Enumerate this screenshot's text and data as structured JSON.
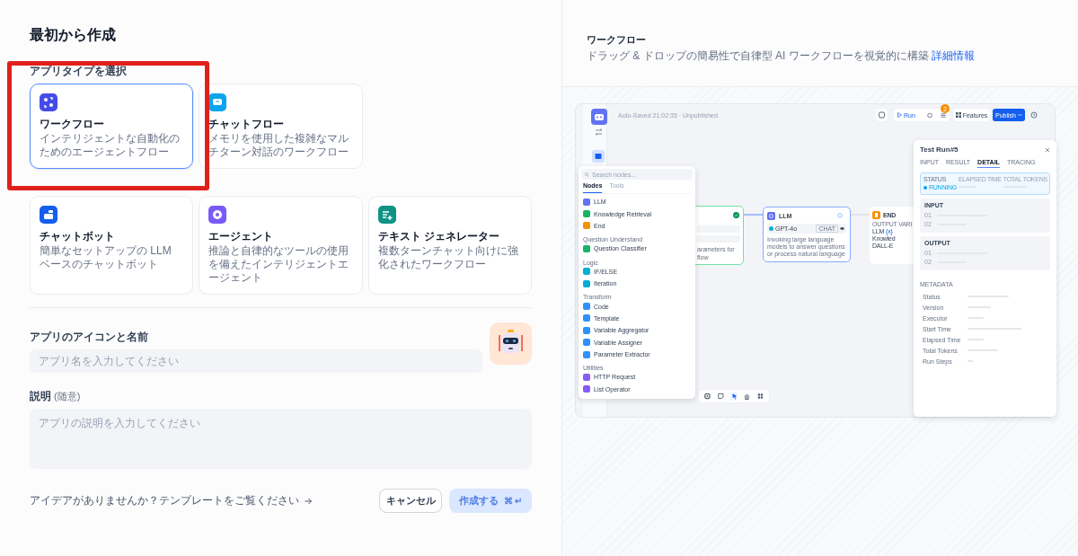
{
  "heading": "最初から作成",
  "app_type_label": "アプリタイプを選択",
  "primary_types": [
    {
      "kind": "workflow",
      "title": "ワークフロー",
      "description": "インテリジェントな自動化のためのエージェントフロー",
      "selected": true,
      "color": "#444ce7"
    },
    {
      "kind": "chatflow",
      "title": "チャットフロー",
      "description": "メモリを使用した複雑なマルチターン対話のワークフロー",
      "selected": false,
      "color": "#0ba5ec"
    }
  ],
  "more_types": [
    {
      "kind": "chatbot",
      "title": "チャットボット",
      "description": "簡単なセットアップの LLM ベースのチャットボット",
      "selected": false,
      "color": "#155eef"
    },
    {
      "kind": "agent",
      "title": "エージェント",
      "description": "推論と自律的なツールの使用を備えたインテリジェントエージェント",
      "selected": false,
      "color": "#7a5af8"
    },
    {
      "kind": "textgen",
      "title": "テキスト ジェネレーター",
      "description": "複数ターンチャット向けに強化されたワークフロー",
      "selected": false,
      "color": "#0e9384"
    }
  ],
  "name_field": {
    "label": "アプリのアイコンと名前",
    "placeholder": "アプリ名を入力してください"
  },
  "description_field": {
    "label": "説明",
    "optional": "(随意)",
    "placeholder": "アプリの説明を入力してください"
  },
  "footer": {
    "template_link": "アイデアがありませんか？テンプレートをご覧ください",
    "cancel": "キャンセル",
    "create": {
      "label": "作成する",
      "shortcut": [
        "⌘",
        "↵"
      ],
      "disabled": true
    }
  },
  "preview": {
    "title": "ワークフロー",
    "description": "ドラッグ & ドロップの簡易性で自律型 AI ワークフローを視覚的に構築",
    "link": "詳細情報",
    "app": {
      "autosave": "Auto-Saved 21:02:35 · Unpublished",
      "run": "Run",
      "badge": "2",
      "features": "Features",
      "publish": "Publish",
      "node_panel": {
        "search_placeholder": "Search nodes...",
        "tabs": [
          {
            "label": "Nodes",
            "selected": true
          },
          {
            "label": "Tools",
            "selected": false
          }
        ],
        "groups": [
          {
            "items": [
              {
                "label": "LLM",
                "color": "#6172f3"
              },
              {
                "label": "Knowledge Retrieval",
                "color": "#16b364"
              },
              {
                "label": "End",
                "color": "#f79009"
              }
            ]
          },
          {
            "title": "Question Understand",
            "items": [
              {
                "label": "Question Classifier",
                "color": "#16b364"
              }
            ]
          },
          {
            "title": "Logic",
            "items": [
              {
                "label": "IF/ELSE",
                "color": "#06aed4"
              },
              {
                "label": "Iteration",
                "color": "#06aed4"
              }
            ]
          },
          {
            "title": "Transform",
            "items": [
              {
                "label": "Code",
                "color": "#2e90fa"
              },
              {
                "label": "Template",
                "color": "#2e90fa"
              },
              {
                "label": "Variable Aggregator",
                "color": "#2e90fa"
              },
              {
                "label": "Variable Assigner",
                "color": "#2e90fa"
              },
              {
                "label": "Parameter Extractor",
                "color": "#2e90fa"
              }
            ]
          },
          {
            "title": "Utilities",
            "items": [
              {
                "label": "HTTP Request",
                "color": "#875bf7"
              },
              {
                "label": "List Operator",
                "color": "#875bf7"
              }
            ]
          }
        ]
      },
      "start_node": {
        "lines": [
          "arameters for",
          "flow"
        ]
      },
      "llm_node": {
        "title": "LLM",
        "model": "GPT-4o",
        "tag": "CHAT",
        "description": "Invoking large language models to answer questions or process natural language"
      },
      "end_node": {
        "title": "END",
        "label": "OUTPUT VARI",
        "outputs": [
          {
            "label": "LLM",
            "var": "{x}"
          },
          {
            "label": "Knowled"
          },
          {
            "label": "DALL-E"
          }
        ]
      },
      "tools": [
        {
          "kind": "gear",
          "selected": false
        },
        {
          "kind": "note",
          "selected": false
        },
        {
          "kind": "pointer",
          "selected": true
        },
        {
          "kind": "hand",
          "selected": false
        },
        {
          "kind": "layout",
          "selected": false
        }
      ],
      "run_panel": {
        "title": "Test Run#5",
        "tabs": [
          {
            "label": "INPUT",
            "selected": false
          },
          {
            "label": "RESULT",
            "selected": false
          },
          {
            "label": "DETAIL",
            "selected": true
          },
          {
            "label": "TRACING",
            "selected": false
          }
        ],
        "status_label": "STATUS",
        "status": "RUNNING",
        "elapsed_label": "ELAPSED TIME",
        "tokens_label": "TOTAL TOKENS",
        "sections": [
          {
            "title": "INPUT",
            "rows": [
              "01",
              "02"
            ]
          },
          {
            "title": "OUTPUT",
            "rows": [
              "01",
              "02"
            ]
          }
        ],
        "metadata_title": "METADATA",
        "metadata": [
          "Status",
          "Version",
          "Executor",
          "Start Time",
          "Elapsed Time",
          "Total Tokens",
          "Run Steps"
        ]
      }
    }
  }
}
